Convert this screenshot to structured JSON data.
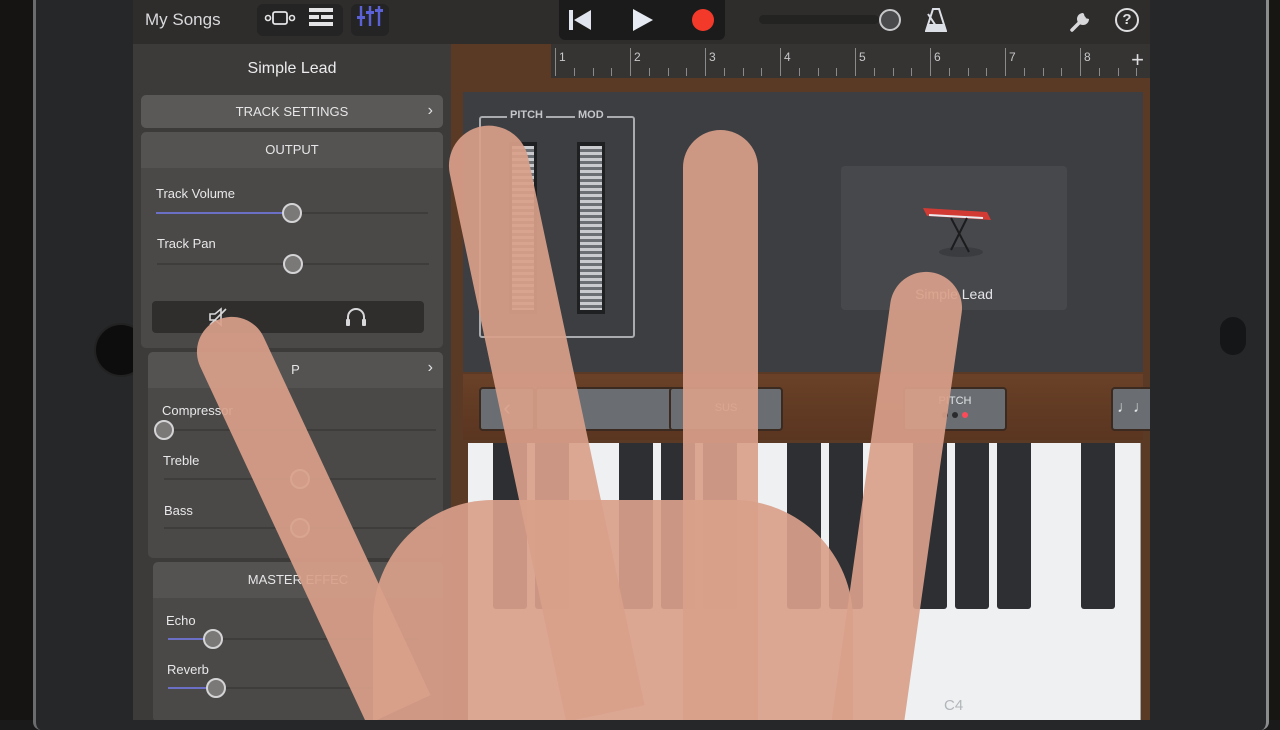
{
  "app": {
    "back_label": "My Songs",
    "view_buttons": [
      {
        "icon": "browser-view-icon",
        "label": "Instrument view"
      },
      {
        "icon": "tracks-view-icon",
        "label": "Tracks view"
      },
      {
        "icon": "mixer-icon",
        "label": "Track controls",
        "active": true
      }
    ],
    "transport": {
      "rewind_icon": "rewind-to-start-icon",
      "play_icon": "play-icon",
      "record_icon": "record-icon"
    },
    "master_volume_fraction": 1.0,
    "right_icons": [
      "count-in-circle-icon",
      "metronome-icon",
      "settings-wrench-icon",
      "help-icon"
    ],
    "help_glyph": "?",
    "accent_color": "#5b62d8",
    "record_color": "#f33a2a"
  },
  "ruler": {
    "bars": [
      "1",
      "2",
      "3",
      "4",
      "5",
      "6",
      "7",
      "8"
    ],
    "add_label": "+"
  },
  "panel": {
    "title": "Simple Lead",
    "track_settings_label": "TRACK SETTINGS",
    "output": {
      "header": "OUTPUT",
      "sliders": [
        {
          "label": "Track Volume",
          "value": 0.5
        },
        {
          "label": "Track Pan",
          "value": 0.5
        }
      ],
      "mute_icon": "mute-speaker-icon",
      "solo_icon": "headphones-icon"
    },
    "plugins": {
      "header_visible": "P",
      "sliders": [
        {
          "label": "Compressor",
          "value": 0.0
        },
        {
          "label": "Treble",
          "value": 0.5
        },
        {
          "label": "Bass",
          "value": 0.5
        }
      ]
    },
    "master_effects": {
      "header_visible": "MASTER EFFEC",
      "sliders": [
        {
          "label": "Echo",
          "value": 0.18
        },
        {
          "label": "Reverb",
          "value": 0.19
        }
      ]
    }
  },
  "instrument": {
    "pitch_label": "PITCH",
    "mod_label": "MOD",
    "preset_name": "Simple Lead",
    "controls": {
      "prev_label": "‹",
      "sustain_visible": "SUS",
      "pitch_mode_label": "PITCH",
      "pitch_mode_dots": 3,
      "pitch_mode_active_dot": 3,
      "arpeggiator_icon": "notes-icon"
    },
    "key_label": "C4"
  }
}
